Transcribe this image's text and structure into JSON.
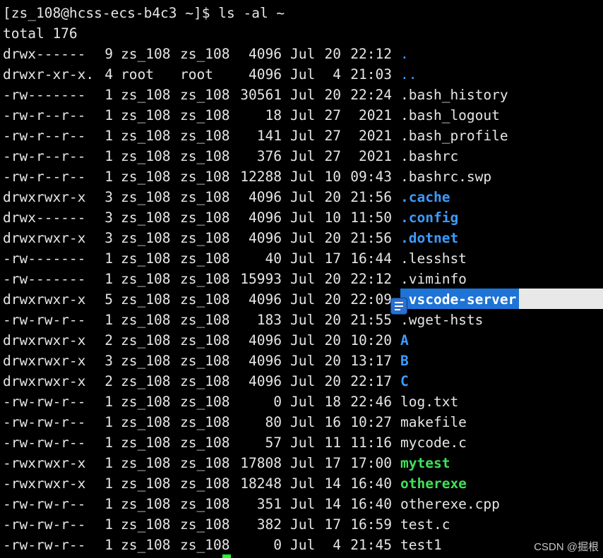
{
  "terminal": {
    "prompt": "[zs_108@hcss-ecs-b4c3 ~]$ ls -al ~",
    "total": "total 176",
    "colors": {
      "background": "#000000",
      "text": "#e6e6e6",
      "directory": "#3b9cff",
      "executable": "#3fe05a",
      "selection": "#1e73d6"
    },
    "entries": [
      {
        "perm": "drwx------",
        "links": "9",
        "owner": "zs_108",
        "group": "zs_108",
        "size": "4096",
        "month": "Jul",
        "day": "20",
        "time": "22:12",
        "name": ".",
        "kind": "dir-dot"
      },
      {
        "perm": "drwxr-xr-x.",
        "links": "4",
        "owner": "root",
        "group": "root",
        "size": "4096",
        "month": "Jul",
        "day": "4",
        "time": "21:03",
        "name": "..",
        "kind": "dir-dot"
      },
      {
        "perm": "-rw-------",
        "links": "1",
        "owner": "zs_108",
        "group": "zs_108",
        "size": "30561",
        "month": "Jul",
        "day": "20",
        "time": "22:24",
        "name": ".bash_history",
        "kind": "file"
      },
      {
        "perm": "-rw-r--r--",
        "links": "1",
        "owner": "zs_108",
        "group": "zs_108",
        "size": "18",
        "month": "Jul",
        "day": "27",
        "time": "2021",
        "name": ".bash_logout",
        "kind": "file"
      },
      {
        "perm": "-rw-r--r--",
        "links": "1",
        "owner": "zs_108",
        "group": "zs_108",
        "size": "141",
        "month": "Jul",
        "day": "27",
        "time": "2021",
        "name": ".bash_profile",
        "kind": "file"
      },
      {
        "perm": "-rw-r--r--",
        "links": "1",
        "owner": "zs_108",
        "group": "zs_108",
        "size": "376",
        "month": "Jul",
        "day": "27",
        "time": "2021",
        "name": ".bashrc",
        "kind": "file"
      },
      {
        "perm": "-rw-r--r--",
        "links": "1",
        "owner": "zs_108",
        "group": "zs_108",
        "size": "12288",
        "month": "Jul",
        "day": "10",
        "time": "09:43",
        "name": ".bashrc.swp",
        "kind": "file"
      },
      {
        "perm": "drwxrwxr-x",
        "links": "3",
        "owner": "zs_108",
        "group": "zs_108",
        "size": "4096",
        "month": "Jul",
        "day": "20",
        "time": "21:56",
        "name": ".cache",
        "kind": "dir"
      },
      {
        "perm": "drwx------",
        "links": "3",
        "owner": "zs_108",
        "group": "zs_108",
        "size": "4096",
        "month": "Jul",
        "day": "10",
        "time": "11:50",
        "name": ".config",
        "kind": "dir"
      },
      {
        "perm": "drwxrwxr-x",
        "links": "3",
        "owner": "zs_108",
        "group": "zs_108",
        "size": "4096",
        "month": "Jul",
        "day": "20",
        "time": "21:56",
        "name": ".dotnet",
        "kind": "dir"
      },
      {
        "perm": "-rw-------",
        "links": "1",
        "owner": "zs_108",
        "group": "zs_108",
        "size": "40",
        "month": "Jul",
        "day": "17",
        "time": "16:44",
        "name": ".lesshst",
        "kind": "file"
      },
      {
        "perm": "-rw-------",
        "links": "1",
        "owner": "zs_108",
        "group": "zs_108",
        "size": "15993",
        "month": "Jul",
        "day": "20",
        "time": "22:12",
        "name": ".viminfo",
        "kind": "file"
      },
      {
        "perm": "drwxrwxr-x",
        "links": "5",
        "owner": "zs_108",
        "group": "zs_108",
        "size": "4096",
        "month": "Jul",
        "day": "20",
        "time": "22:09",
        "name": ".vscode-server",
        "kind": "selected"
      },
      {
        "perm": "-rw-rw-r--",
        "links": "1",
        "owner": "zs_108",
        "group": "zs_108",
        "size": "183",
        "month": "Jul",
        "day": "20",
        "time": "21:55",
        "name": ".wget-hsts",
        "kind": "file"
      },
      {
        "perm": "drwxrwxr-x",
        "links": "2",
        "owner": "zs_108",
        "group": "zs_108",
        "size": "4096",
        "month": "Jul",
        "day": "20",
        "time": "10:20",
        "name": "A",
        "kind": "dir"
      },
      {
        "perm": "drwxrwxr-x",
        "links": "3",
        "owner": "zs_108",
        "group": "zs_108",
        "size": "4096",
        "month": "Jul",
        "day": "20",
        "time": "13:17",
        "name": "B",
        "kind": "dir"
      },
      {
        "perm": "drwxrwxr-x",
        "links": "2",
        "owner": "zs_108",
        "group": "zs_108",
        "size": "4096",
        "month": "Jul",
        "day": "20",
        "time": "22:17",
        "name": "C",
        "kind": "dir"
      },
      {
        "perm": "-rw-rw-r--",
        "links": "1",
        "owner": "zs_108",
        "group": "zs_108",
        "size": "0",
        "month": "Jul",
        "day": "18",
        "time": "22:46",
        "name": "log.txt",
        "kind": "file"
      },
      {
        "perm": "-rw-rw-r--",
        "links": "1",
        "owner": "zs_108",
        "group": "zs_108",
        "size": "80",
        "month": "Jul",
        "day": "16",
        "time": "10:27",
        "name": "makefile",
        "kind": "file"
      },
      {
        "perm": "-rw-rw-r--",
        "links": "1",
        "owner": "zs_108",
        "group": "zs_108",
        "size": "57",
        "month": "Jul",
        "day": "11",
        "time": "11:16",
        "name": "mycode.c",
        "kind": "file"
      },
      {
        "perm": "-rwxrwxr-x",
        "links": "1",
        "owner": "zs_108",
        "group": "zs_108",
        "size": "17808",
        "month": "Jul",
        "day": "17",
        "time": "17:00",
        "name": "mytest",
        "kind": "exec"
      },
      {
        "perm": "-rwxrwxr-x",
        "links": "1",
        "owner": "zs_108",
        "group": "zs_108",
        "size": "18248",
        "month": "Jul",
        "day": "14",
        "time": "16:40",
        "name": "otherexe",
        "kind": "exec"
      },
      {
        "perm": "-rw-rw-r--",
        "links": "1",
        "owner": "zs_108",
        "group": "zs_108",
        "size": "351",
        "month": "Jul",
        "day": "14",
        "time": "16:40",
        "name": "otherexe.cpp",
        "kind": "file"
      },
      {
        "perm": "-rw-rw-r--",
        "links": "1",
        "owner": "zs_108",
        "group": "zs_108",
        "size": "382",
        "month": "Jul",
        "day": "17",
        "time": "16:59",
        "name": "test.c",
        "kind": "file"
      },
      {
        "perm": "-rw-rw-r--",
        "links": "1",
        "owner": "zs_108",
        "group": "zs_108",
        "size": "0",
        "month": "Jul",
        "day": "4",
        "time": "21:45",
        "name": "test1",
        "kind": "file"
      }
    ]
  },
  "watermark": "CSDN @掘根",
  "icons": {
    "floating": "document-list-icon",
    "cursor": "terminal-cursor"
  }
}
